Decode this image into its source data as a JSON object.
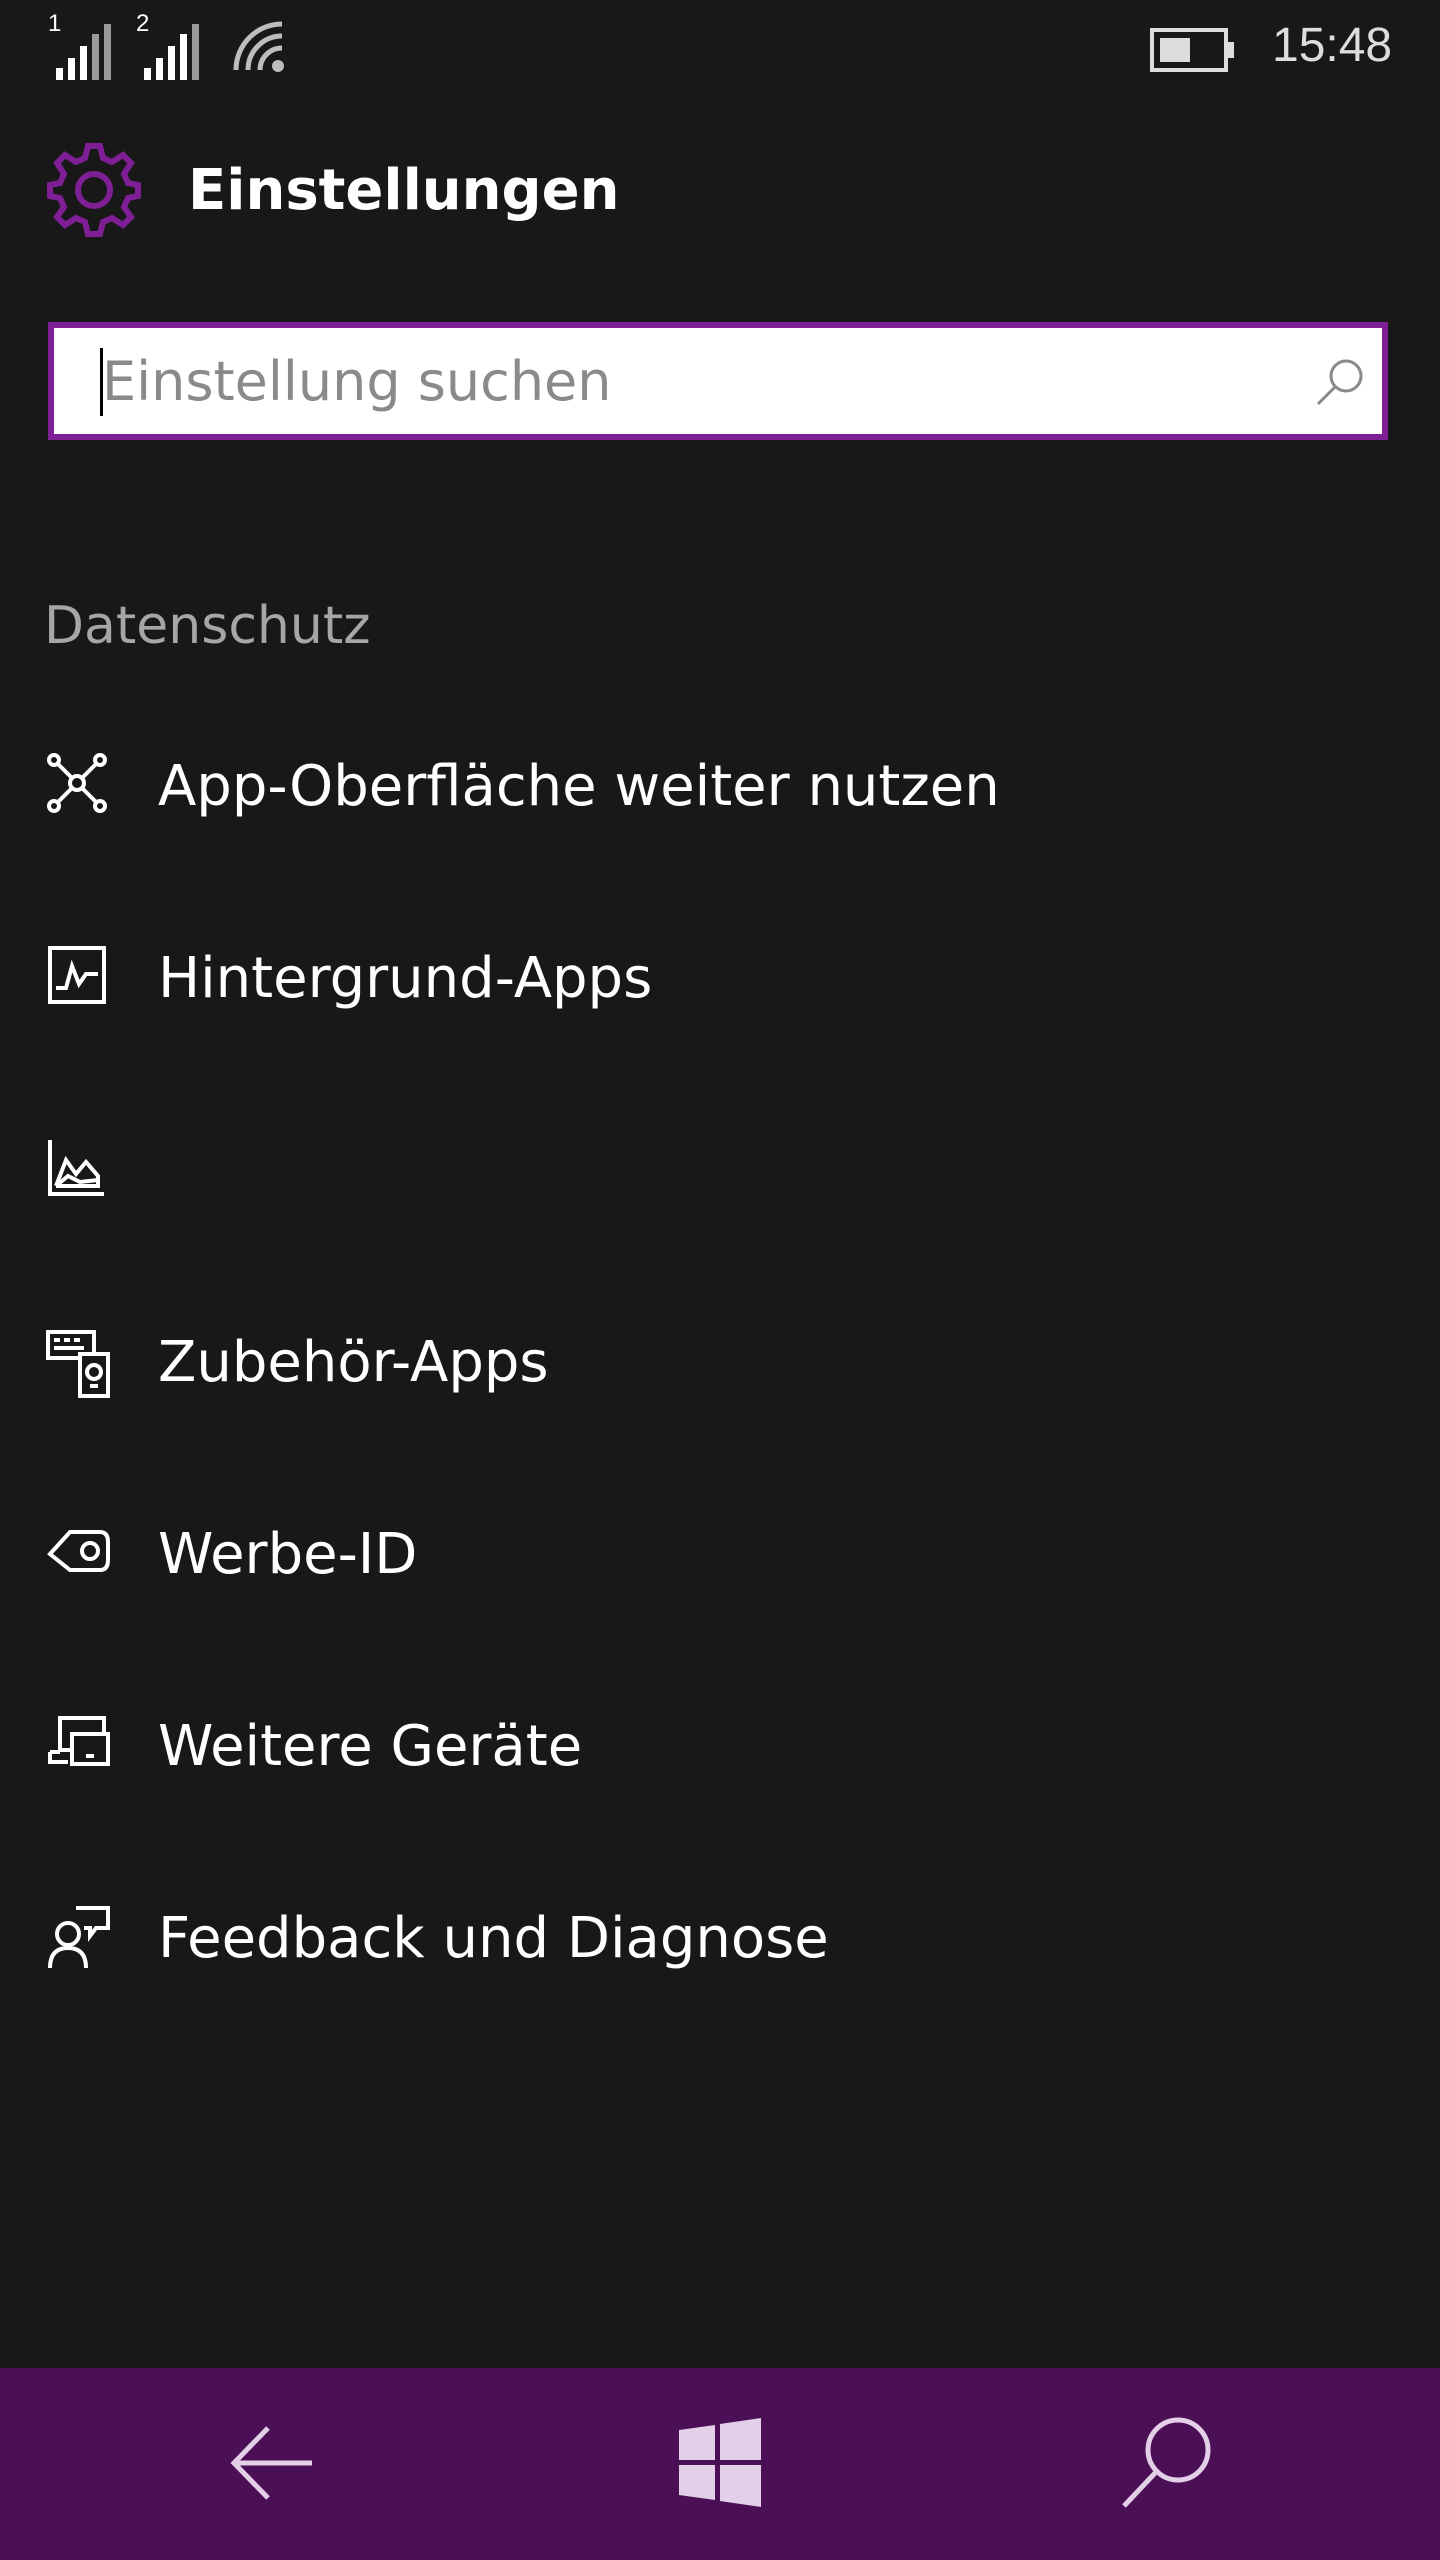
{
  "status_bar": {
    "sim1_label": "1",
    "sim2_label": "2",
    "time": "15:48",
    "icons": [
      "signal-bars-icon",
      "signal-bars-icon",
      "wifi-icon",
      "battery-icon"
    ]
  },
  "header": {
    "title": "Einstellungen",
    "icon": "gear-icon",
    "accent_color": "#7e1f96"
  },
  "search": {
    "placeholder": "Einstellung suchen",
    "value": "",
    "icon": "search-icon"
  },
  "section": {
    "title": "Datenschutz"
  },
  "menu_items": [
    {
      "label": "App-Oberfläche weiter nutzen",
      "icon": "network-nodes-icon"
    },
    {
      "label": "Hintergrund-Apps",
      "icon": "activity-chart-icon"
    },
    {
      "label": "",
      "icon": "area-chart-icon"
    },
    {
      "label": "Zubehör-Apps",
      "icon": "accessory-apps-icon"
    },
    {
      "label": "Werbe-ID",
      "icon": "tag-icon"
    },
    {
      "label": "Weitere Geräte",
      "icon": "devices-icon"
    },
    {
      "label": "Feedback und Diagnose",
      "icon": "person-feedback-icon"
    }
  ],
  "navbar": {
    "background": "#4b0f56",
    "buttons": [
      "back-arrow-icon",
      "windows-logo-icon",
      "search-icon"
    ]
  }
}
